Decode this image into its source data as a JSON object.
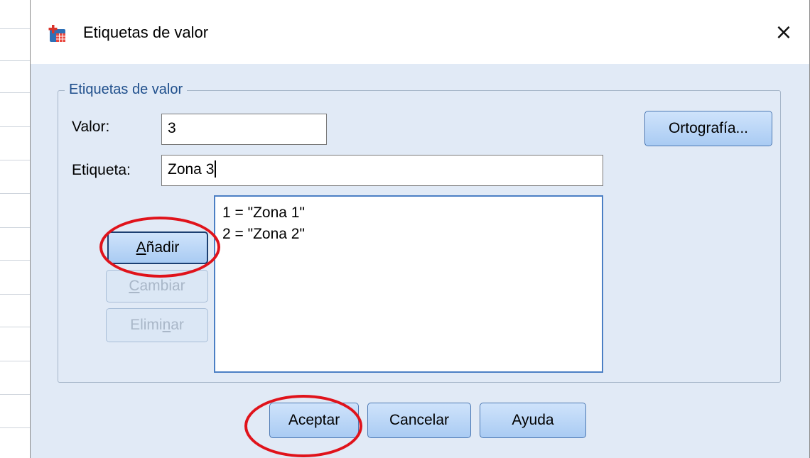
{
  "dialog": {
    "title": "Etiquetas de valor",
    "close_glyph": "×",
    "icon": "spss-value-labels-icon"
  },
  "group": {
    "legend": "Etiquetas de valor",
    "valor_label": "Valor:",
    "valor_value": "3",
    "etiqueta_label": "Etiqueta:",
    "etiqueta_value": "Zona 3",
    "spelling_button": "Ortografía...",
    "buttons": {
      "add": {
        "pre": "",
        "u": "A",
        "post": "ñadir"
      },
      "change": {
        "pre": "",
        "u": "C",
        "post": "ambiar"
      },
      "remove": {
        "pre": "Elimi",
        "u": "n",
        "post": "ar"
      }
    },
    "list_items": [
      "1 = \"Zona 1\"",
      "2 = \"Zona 2\""
    ]
  },
  "footer": {
    "ok": "Aceptar",
    "cancel": "Cancelar",
    "help": "Ayuda"
  },
  "colors": {
    "dialog_bg": "#e1eaf6",
    "legend_text": "#1f4f8c",
    "highlight_ellipse": "#e0131b",
    "list_border": "#4b7fc4"
  }
}
